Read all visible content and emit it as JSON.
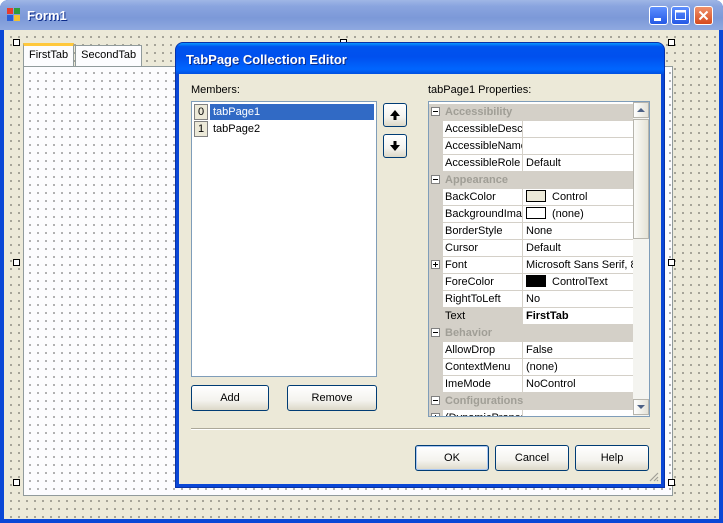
{
  "form": {
    "title": "Form1",
    "tabs": [
      {
        "label": "FirstTab"
      },
      {
        "label": "SecondTab"
      }
    ]
  },
  "dialog": {
    "title": "TabPage Collection Editor",
    "members_label": "Members:",
    "members": [
      {
        "index": "0",
        "name": "tabPage1",
        "selected": true
      },
      {
        "index": "1",
        "name": "tabPage2",
        "selected": false
      }
    ],
    "add_label": "Add",
    "remove_label": "Remove",
    "properties_label": "tabPage1 Properties:",
    "properties": [
      {
        "kind": "category",
        "name": "Accessibility"
      },
      {
        "kind": "prop",
        "name": "AccessibleDescr",
        "value": ""
      },
      {
        "kind": "prop",
        "name": "AccessibleName",
        "value": ""
      },
      {
        "kind": "prop",
        "name": "AccessibleRole",
        "value": "Default"
      },
      {
        "kind": "category",
        "name": "Appearance"
      },
      {
        "kind": "prop",
        "name": "BackColor",
        "value": "Control",
        "swatch": "#ece9d8"
      },
      {
        "kind": "prop",
        "name": "BackgroundImag",
        "value": "(none)",
        "swatch": "#ffffff"
      },
      {
        "kind": "prop",
        "name": "BorderStyle",
        "value": "None"
      },
      {
        "kind": "prop",
        "name": "Cursor",
        "value": "Default"
      },
      {
        "kind": "prop",
        "name": "Font",
        "value": "Microsoft Sans Serif, 8",
        "expand": true
      },
      {
        "kind": "prop",
        "name": "ForeColor",
        "value": "ControlText",
        "swatch": "#000000"
      },
      {
        "kind": "prop",
        "name": "RightToLeft",
        "value": "No"
      },
      {
        "kind": "prop",
        "name": "Text",
        "value": "FirstTab",
        "highlight": true
      },
      {
        "kind": "category",
        "name": "Behavior"
      },
      {
        "kind": "prop",
        "name": "AllowDrop",
        "value": "False"
      },
      {
        "kind": "prop",
        "name": "ContextMenu",
        "value": "(none)"
      },
      {
        "kind": "prop",
        "name": "ImeMode",
        "value": "NoControl"
      },
      {
        "kind": "category",
        "name": "Configurations"
      },
      {
        "kind": "prop",
        "name": "(DynamicProper",
        "value": "",
        "expand": true
      }
    ],
    "ok_label": "OK",
    "cancel_label": "Cancel",
    "help_label": "Help"
  }
}
